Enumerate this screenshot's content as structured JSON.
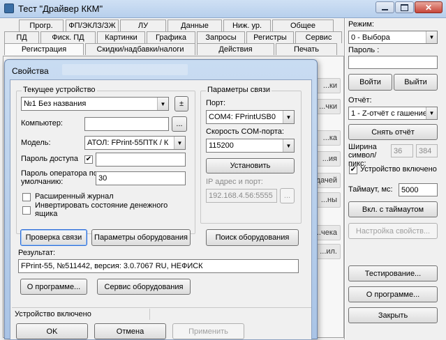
{
  "main_window": {
    "title": "Тест \"Драйвер ККМ\"",
    "tabs_row1": [
      "Прогр.",
      "ФП/ЭКЛЗ/ЗЖ",
      "ЛУ",
      "Данные",
      "Ниж. ур.",
      "Общее"
    ],
    "tabs_row2": [
      "ПД",
      "Фиск. ПД",
      "Картинки",
      "Графика",
      "Запросы",
      "Регистры",
      "Сервис"
    ],
    "tabs_row3": [
      "Регистрация",
      "Скидки/надбавки/налоги",
      "Действия",
      "Печать"
    ],
    "behind_buttons": [
      "...ки",
      "...чки",
      "...ка",
      "...ия",
      "...дачей",
      "...ны",
      "...чека",
      "...ил."
    ]
  },
  "right_panel": {
    "mode_label": "Режим:",
    "mode_value": "0 - Выбора",
    "password_label": "Пароль :",
    "password_value": "",
    "login_button": "Войти",
    "logout_button": "Выйти",
    "report_label": "Отчёт:",
    "report_value": "1 - Z-отчёт с гашение",
    "remove_report_button": "Снять отчёт",
    "width_label": "Ширина символ/пикс:",
    "width_chars": "36",
    "width_pixels": "384",
    "device_enabled_label": "Устройство включено",
    "device_enabled_checked": true,
    "timeout_label": "Таймаут, мс:",
    "timeout_value": "5000",
    "timeout_button": "Вкл. с таймаутом",
    "properties_button": "Настройка свойств...",
    "testing_button": "Тестирование...",
    "about_button": "О программе...",
    "close_button": "Закрыть"
  },
  "dialog": {
    "title": "Свойства",
    "current_device_group": "Текущее устройство",
    "device_value": "№1 Без названия",
    "plusminus": "±",
    "computer_label": "Компьютер:",
    "computer_value": "",
    "browse": "...",
    "model_label": "Модель:",
    "model_value": "АТОЛ: FPrint-55ПТК / К",
    "access_password_label": "Пароль доступа",
    "access_password_checked": true,
    "access_password_value": "",
    "operator_password_label": "Пароль оператора по умолчанию:",
    "operator_password_value": "30",
    "extended_log_label": "Расширенный журнал",
    "invert_drawer_label": "Инвертировать состояние денежного ящика",
    "comm_params_group": "Параметры связи",
    "port_label": "Порт:",
    "port_value": "COM4: FPrintUSB0",
    "speed_label": "Скорость COM-порта:",
    "speed_value": "115200",
    "set_button": "Установить",
    "ip_label": "IP адрес и порт:",
    "ip_value": "192.168.4.56:5555",
    "ip_browse": "...",
    "check_connection_button": "Проверка связи",
    "hardware_params_button": "Параметры оборудования",
    "search_hardware_button": "Поиск оборудования",
    "result_label": "Результат:",
    "result_value": "FPrint-55, №511442, версия: 3.0.7067 RU, НЕФИСК",
    "about_button": "О программе...",
    "hardware_service_button": "Сервис оборудования",
    "status_text": "Устройство включено",
    "ok_button": "OK",
    "cancel_button": "Отмена",
    "apply_button": "Применить"
  }
}
